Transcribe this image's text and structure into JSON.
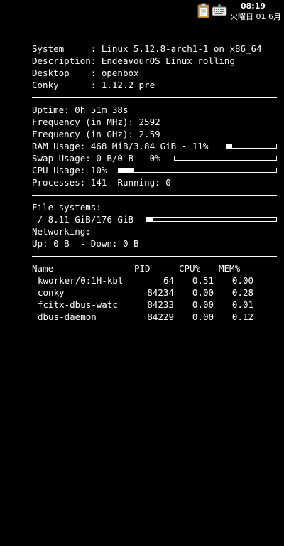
{
  "tray": {
    "clipboard_icon": "clipboard-icon",
    "keyboard_icon": "keyboard-icon",
    "time": "08:19",
    "date": "火曜日 01 6月"
  },
  "system": {
    "system_label": "System     :",
    "system_value": "Linux 5.12.8-arch1-1 on x86_64",
    "description_label": "Description:",
    "description_value": "EndeavourOS Linux rolling",
    "desktop_label": "Desktop    :",
    "desktop_value": "openbox",
    "conky_label": "Conky      :",
    "conky_value": "1.12.2_pre"
  },
  "stats": {
    "uptime_label": "Uptime:",
    "uptime_value": "0h 51m 38s",
    "freq_mhz_label": "Frequency (in MHz):",
    "freq_mhz_value": "2592",
    "freq_ghz_label": "Frequency (in GHz):",
    "freq_ghz_value": "2.59",
    "ram_label": "RAM Usage:",
    "ram_value": "468 MiB/3.84 GiB - 11%",
    "ram_percent": 11,
    "swap_label": "Swap Usage:",
    "swap_value": "0 B/0 B - 0%",
    "swap_percent": 0,
    "cpu_label": "CPU Usage:",
    "cpu_value": "10%",
    "cpu_percent": 10,
    "processes_label": "Processes:",
    "processes_value": "141",
    "running_label": "Running:",
    "running_value": "0"
  },
  "filesystems": {
    "header": "File systems:",
    "root_label": "/",
    "root_value": "8.11 GiB/176 GiB",
    "root_percent": 5,
    "networking_label": "Networking:",
    "up_label": "Up:",
    "up_value": "0 B",
    "down_label": "- Down:",
    "down_value": "0 B"
  },
  "processes": {
    "headers": {
      "name": "Name",
      "pid": "PID",
      "cpu": "CPU%",
      "mem": "MEM%"
    },
    "rows": [
      {
        "name": "kworker/0:1H-kbl",
        "pid": "64",
        "cpu": "0.51",
        "mem": "0.00"
      },
      {
        "name": "conky",
        "pid": "84234",
        "cpu": "0.00",
        "mem": "0.28"
      },
      {
        "name": "fcitx-dbus-watc",
        "pid": "84233",
        "cpu": "0.00",
        "mem": "0.01"
      },
      {
        "name": "dbus-daemon",
        "pid": "84229",
        "cpu": "0.00",
        "mem": "0.12"
      }
    ]
  }
}
